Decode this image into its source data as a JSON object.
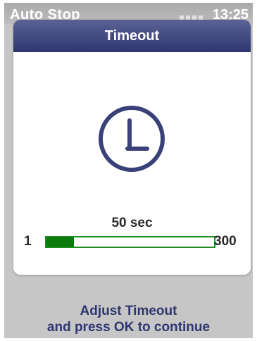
{
  "status_bar": {
    "title": "Auto Stop",
    "time": "13:25"
  },
  "dialog": {
    "title": "Timeout",
    "icon": "clock-icon",
    "slider": {
      "value_text": "50 sec",
      "min_label": "1",
      "max_label": "300",
      "value": 50,
      "min": 1,
      "max": 300
    }
  },
  "instructions": {
    "line1": "Adjust Timeout",
    "line2": "and press OK to continue"
  },
  "colors": {
    "header": "#3a4178",
    "slider": "#0a7a0a",
    "icon": "#3a4178",
    "background": "#c6c6c6"
  }
}
